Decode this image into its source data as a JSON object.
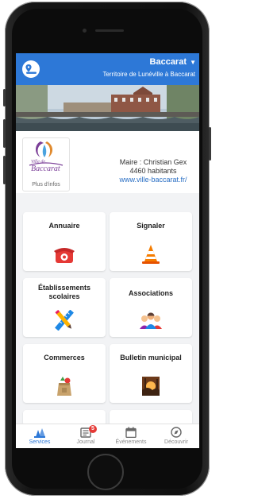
{
  "header": {
    "title": "Baccarat",
    "subtitle": "Territoire de Lunéville à Baccarat",
    "location_icon": "map-pin-icon",
    "dropdown_icon": "caret-down-icon"
  },
  "commune": {
    "logo_text_line1": "Ville de",
    "logo_text_line2": "Baccarat",
    "more_info": "Plus d'infos",
    "mayor": "Maire : Christian Gex",
    "population": "4460 habitants",
    "website": "www.ville-baccarat.fr/"
  },
  "tiles": [
    {
      "label": "Annuaire",
      "icon": "telephone-icon"
    },
    {
      "label": "Signaler",
      "icon": "traffic-cone-icon"
    },
    {
      "label": "Établissements scolaires",
      "icon": "pencil-ruler-icon"
    },
    {
      "label": "Associations",
      "icon": "people-icon"
    },
    {
      "label": "Commerces",
      "icon": "grocery-bag-icon"
    },
    {
      "label": "Bulletin municipal",
      "icon": "newspaper-image-icon"
    }
  ],
  "bottom_nav": [
    {
      "label": "Services",
      "icon": "services-icon",
      "active": true
    },
    {
      "label": "Journal",
      "icon": "journal-icon",
      "badge": "5"
    },
    {
      "label": "Événements",
      "icon": "calendar-icon"
    },
    {
      "label": "Découvrir",
      "icon": "compass-icon"
    }
  ],
  "colors": {
    "primary": "#2d78d7",
    "badge": "#e53935",
    "background": "#f2f3f5"
  }
}
